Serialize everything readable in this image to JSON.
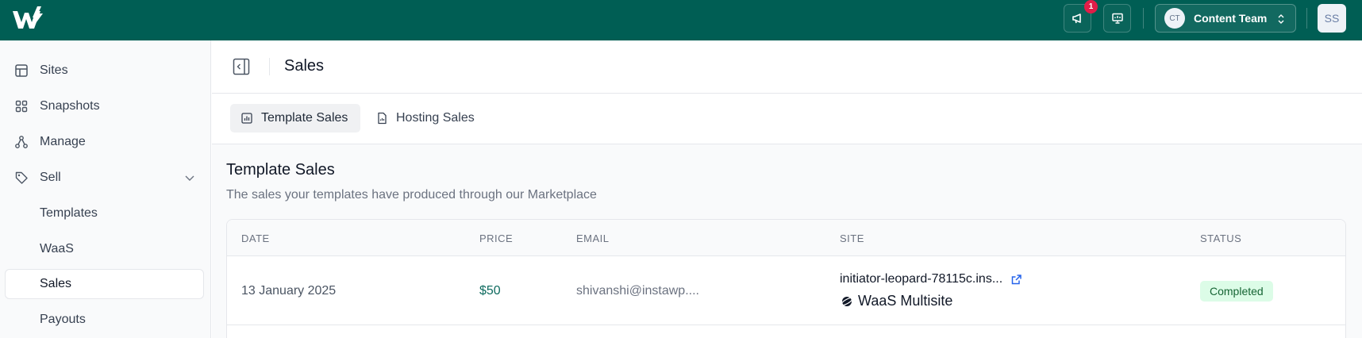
{
  "topbar": {
    "notification_count": "1",
    "team_initials": "CT",
    "team_name": "Content Team",
    "user_initials": "SS"
  },
  "sidebar": {
    "items": [
      {
        "label": "Sites",
        "icon": "layout-icon"
      },
      {
        "label": "Snapshots",
        "icon": "grid-icon"
      },
      {
        "label": "Manage",
        "icon": "network-icon"
      },
      {
        "label": "Sell",
        "icon": "tag-icon"
      },
      {
        "label": "Templates"
      },
      {
        "label": "WaaS"
      },
      {
        "label": "Sales"
      },
      {
        "label": "Payouts"
      }
    ],
    "active": "Sales"
  },
  "header": {
    "title": "Sales"
  },
  "tabs": [
    {
      "label": "Template Sales",
      "icon": "chart-icon",
      "active": true
    },
    {
      "label": "Hosting Sales",
      "icon": "document-icon",
      "active": false
    }
  ],
  "section": {
    "title": "Template Sales",
    "subtitle": "The sales your templates have produced through our Marketplace"
  },
  "table": {
    "columns": [
      "DATE",
      "PRICE",
      "EMAIL",
      "SITE",
      "STATUS"
    ],
    "rows": [
      {
        "date": "13 January 2025",
        "price": "$50",
        "email": "shivanshi@instawp....",
        "site": "initiator-leopard-78115c.ins...",
        "plan": "WaaS Multisite",
        "status": "Completed"
      }
    ]
  },
  "colors": {
    "topbar": "#005e54",
    "accent_price": "#0f6b5f",
    "status_bg": "#dcfce7",
    "status_text": "#166534",
    "badge": "#e11d48"
  }
}
